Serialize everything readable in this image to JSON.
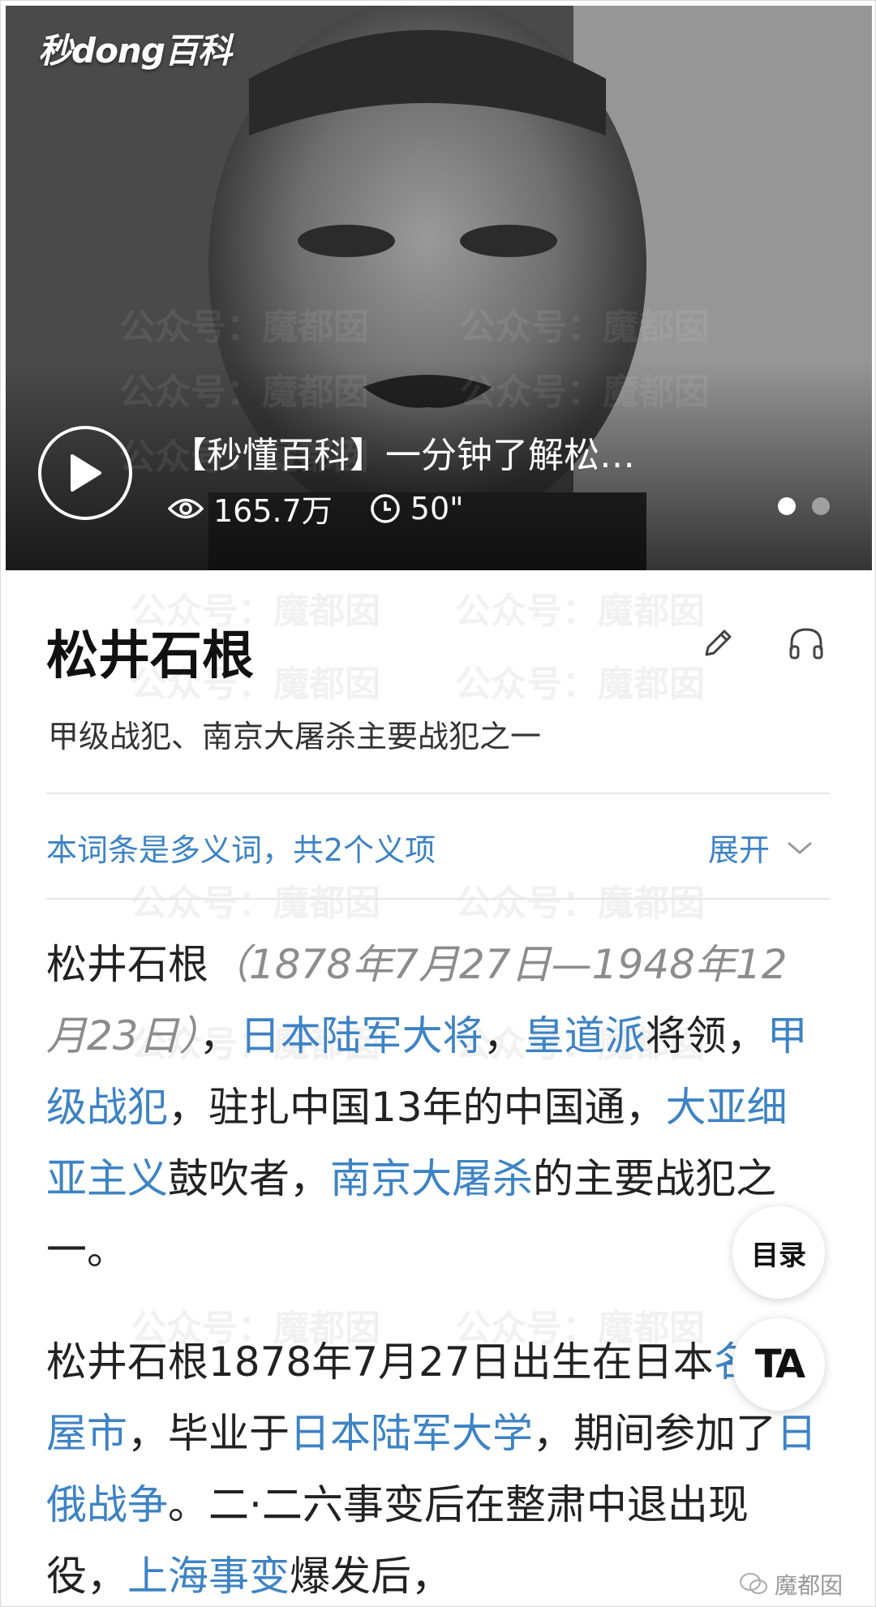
{
  "hero": {
    "brand": "秒dong百科",
    "video_title": "【秒懂百科】一分钟了解松…",
    "views": "165.7万",
    "duration": "50\"",
    "slide_count": 2,
    "active_slide": 1
  },
  "watermark": "公众号：魔都囡",
  "entry": {
    "title": "松井石根",
    "subtitle": "甲级战犯、南京大屠杀主要战犯之一",
    "polysemy_text": "本词条是多义词，共2个义项",
    "expand_label": "展开"
  },
  "para1": {
    "name": "松井石根",
    "dates": "（1878年7月27日—1948年12月23日）",
    "sep1": "，",
    "link_army_general": "日本陆军大将",
    "sep2": "，",
    "link_kodoha": "皇道派",
    "text_general": "将领，",
    "link_class_a": "甲级战犯",
    "text_china": "，驻扎中国13年的中国通，",
    "link_pan_asia": "大亚细亚主义",
    "text_promoter": "鼓吹者，",
    "link_nanjing": "南京大屠杀",
    "text_end": "的主要战犯之一。"
  },
  "para2": {
    "text_born": "松井石根1878年7月27日出生在日本",
    "link_nagoya": "名古屋市",
    "text_grad": "，毕业于",
    "link_army_univ": "日本陆军大学",
    "text_period": "，期间参加了",
    "link_russo": "日俄战争",
    "text_226": "。二·二六事变后在整肃中退出现役，",
    "link_shanghai": "上海事变",
    "text_after": "爆发后，"
  },
  "floating": {
    "toc_label": "目录",
    "font_label": "TA"
  },
  "footer_watermark": "魔都囡",
  "colors": {
    "link": "#3d83c5",
    "text": "#222222",
    "muted": "#8c8c8c"
  }
}
